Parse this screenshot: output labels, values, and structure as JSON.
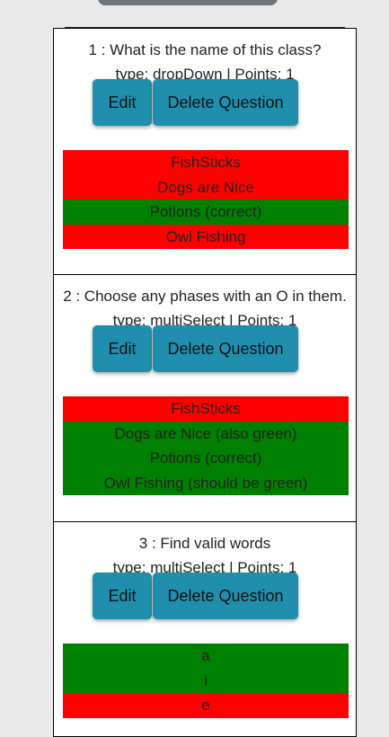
{
  "colors": {
    "wrong": "#ff0000",
    "correct": "#008000",
    "button": "#1f8fad"
  },
  "buttons": {
    "edit_label": "Edit",
    "delete_label": "Delete Question"
  },
  "questions": [
    {
      "title": "1 : What is the name of this class?",
      "type_line": "type: dropDown | Points: 1",
      "answers": [
        {
          "text": "FishSticks",
          "correct": false
        },
        {
          "text": "Dogs are Nice",
          "correct": false
        },
        {
          "text": "Potions (correct)",
          "correct": true
        },
        {
          "text": "Owl Fishing",
          "correct": false
        }
      ]
    },
    {
      "title": "2 : Choose any phases with an O in them.",
      "type_line": "type: multiSelect | Points: 1",
      "answers": [
        {
          "text": "FishSticks",
          "correct": false
        },
        {
          "text": "Dogs are Nice (also green)",
          "correct": true
        },
        {
          "text": "Potions (correct)",
          "correct": true
        },
        {
          "text": "Owl Fishing (should be green)",
          "correct": true
        }
      ]
    },
    {
      "title": "3 : Find valid words",
      "type_line": "type: multiSelect | Points: 1",
      "answers": [
        {
          "text": "a",
          "correct": true
        },
        {
          "text": "i",
          "correct": true
        },
        {
          "text": "e",
          "correct": false
        }
      ]
    }
  ]
}
